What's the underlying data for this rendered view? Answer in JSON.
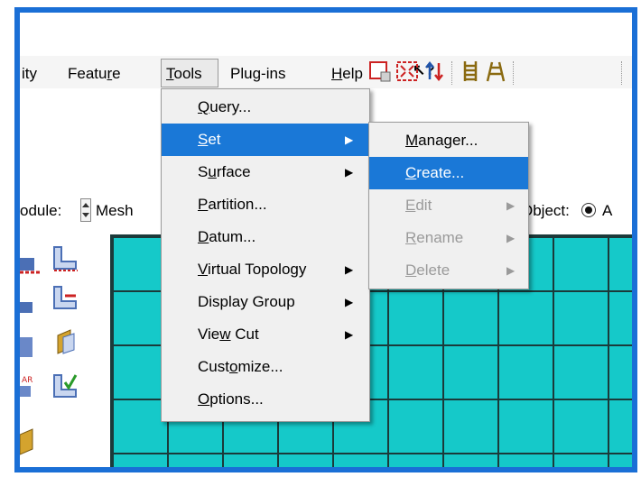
{
  "menubar": {
    "items": [
      {
        "label": "ity"
      },
      {
        "label": "Feature"
      },
      {
        "label": "Tools"
      },
      {
        "label": "Plug-ins"
      },
      {
        "label": "Help"
      }
    ]
  },
  "module": {
    "label": "odule:",
    "value": "Mesh",
    "object_label": "Object:",
    "object_value": "A"
  },
  "tools_menu": {
    "items": [
      {
        "label": "Query...",
        "submenu": false
      },
      {
        "label": "Set",
        "submenu": true,
        "selected": true
      },
      {
        "label": "Surface",
        "submenu": true
      },
      {
        "label": "Partition...",
        "submenu": false
      },
      {
        "label": "Datum...",
        "submenu": false
      },
      {
        "label": "Virtual Topology",
        "submenu": true
      },
      {
        "label": "Display Group",
        "submenu": true
      },
      {
        "label": "View Cut",
        "submenu": true
      },
      {
        "label": "Customize...",
        "submenu": false
      },
      {
        "label": "Options...",
        "submenu": false
      }
    ]
  },
  "set_submenu": {
    "items": [
      {
        "label": "Manager...",
        "enabled": true
      },
      {
        "label": "Create...",
        "enabled": true,
        "selected": true
      },
      {
        "label": "Edit",
        "enabled": false,
        "submenu": true
      },
      {
        "label": "Rename",
        "enabled": false,
        "submenu": true
      },
      {
        "label": "Delete",
        "enabled": false,
        "submenu": true
      }
    ]
  },
  "colors": {
    "frame_border": "#1a6fd6",
    "selection": "#1a78d7",
    "mesh_fill": "#15c9c9",
    "mesh_lines": "#1b3a3a"
  },
  "icons": {
    "help_cursor": "arrow-question-icon"
  }
}
